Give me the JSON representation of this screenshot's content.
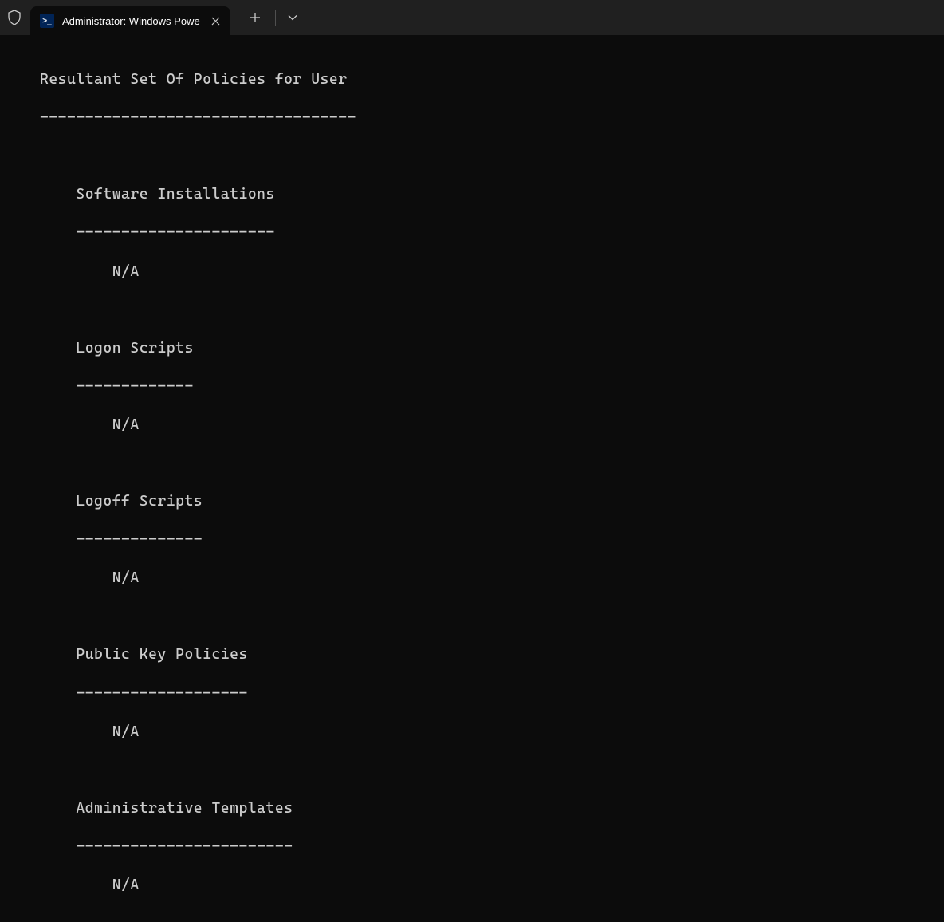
{
  "titlebar": {
    "tab_title": "Administrator: Windows Powe"
  },
  "terminal": {
    "header": "Resultant Set Of Policies for User",
    "header_underline": "-----------------------------------",
    "sections": [
      {
        "title": "Software Installations",
        "underline": "----------------------",
        "value": "N/A"
      },
      {
        "title": "Logon Scripts",
        "underline": "-------------",
        "value": "N/A"
      },
      {
        "title": "Logoff Scripts",
        "underline": "--------------",
        "value": "N/A"
      },
      {
        "title": "Public Key Policies",
        "underline": "-------------------",
        "value": "N/A"
      },
      {
        "title": "Administrative Templates",
        "underline": "------------------------",
        "value": "N/A"
      }
    ]
  }
}
